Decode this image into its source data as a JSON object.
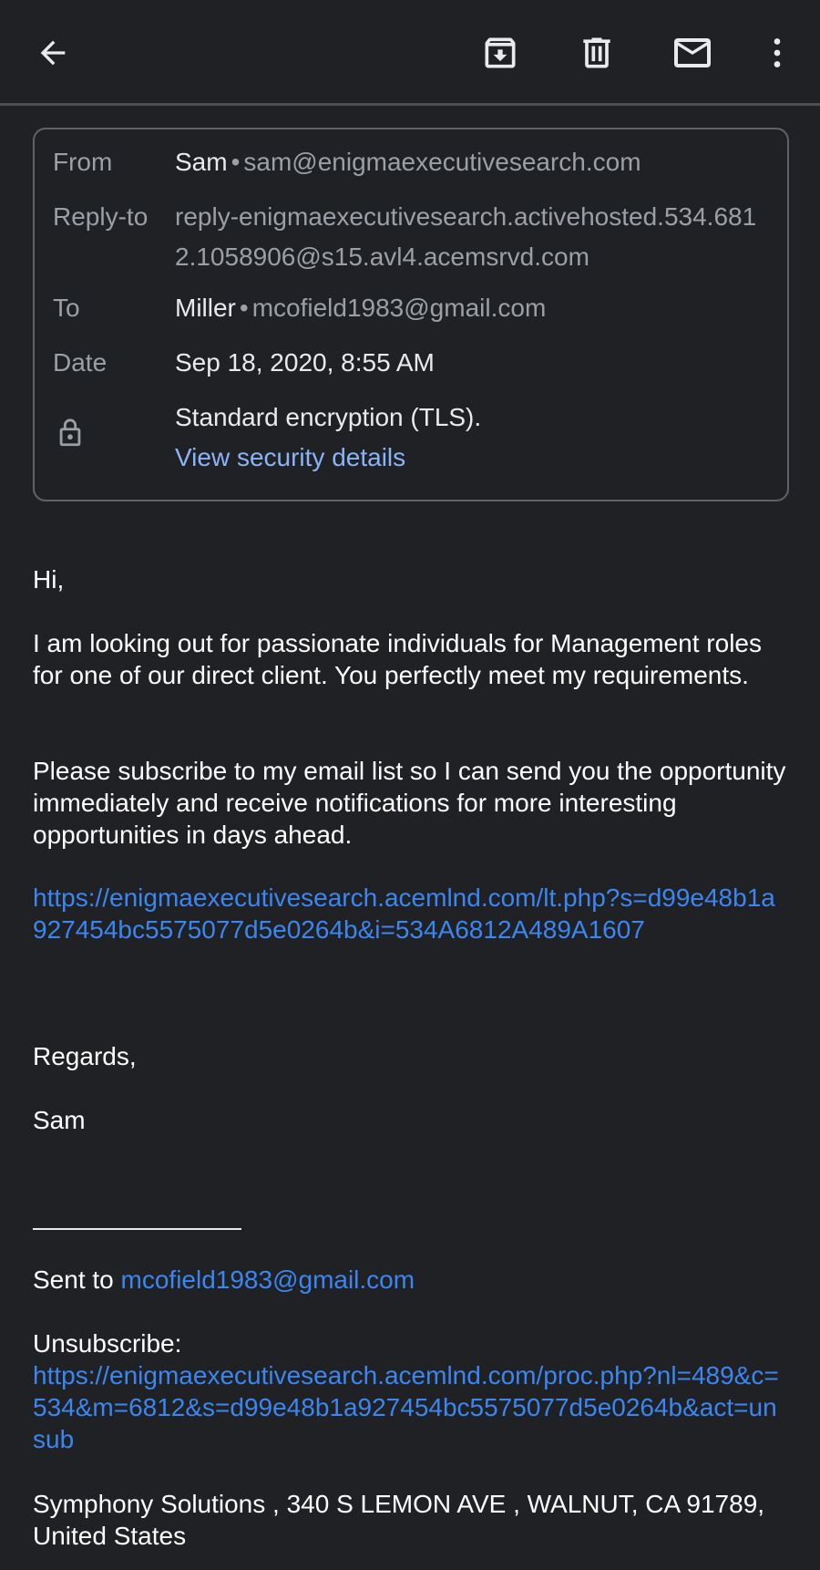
{
  "toolbar": {
    "back_icon": "arrow-back-icon",
    "archive_icon": "archive-icon",
    "delete_icon": "trash-icon",
    "unread_icon": "mail-icon",
    "more_icon": "more-vert-icon"
  },
  "details": {
    "from_label": "From",
    "from_name": "Sam",
    "from_email": "sam@enigmaexecutivesearch.com",
    "replyto_label": "Reply-to",
    "replyto_value": "reply-enigmaexecutivesearch.activehosted.534.6812.1058906@s15.avl4.acemsrvd.com",
    "to_label": "To",
    "to_name": "Miller",
    "to_email": "mcofield1983@gmail.com",
    "date_label": "Date",
    "date_value": "Sep 18, 2020, 8:55 AM",
    "security_icon": "lock-icon",
    "security_text": "Standard encryption (TLS).",
    "security_link": "View security details"
  },
  "message": {
    "greeting": "Hi,",
    "paragraph1": "I am looking out for passionate individuals for Management roles for one of our direct client. You perfectly meet my requirements.",
    "paragraph2": "Please subscribe to my email list so I can send you the opportunity immediately and receive notifications for more interesting opportunities in days ahead.",
    "subscribe_link": "https://enigmaexecutivesearch.acemlnd.com/lt.php?s=d99e48b1a927454bc5575077d5e0264b&i=534A6812A489A1607",
    "signoff": "Regards,",
    "signature": "Sam"
  },
  "footer": {
    "sent_to_label": "Sent to",
    "sent_to_email": "mcofield1983@gmail.com",
    "unsubscribe_label": "Unsubscribe:",
    "unsubscribe_link": "https://enigmaexecutivesearch.acemlnd.com/proc.php?nl=489&c=534&m=6812&s=d99e48b1a927454bc5575077d5e0264b&act=unsub",
    "address": "Symphony Solutions , 340 S LEMON AVE , WALNUT, CA 91789, United States"
  },
  "colors": {
    "background": "#202124",
    "text": "#e8eaed",
    "secondary_text": "#9aa0a6",
    "link": "#3b86f0",
    "security_link": "#8ab4f8"
  }
}
